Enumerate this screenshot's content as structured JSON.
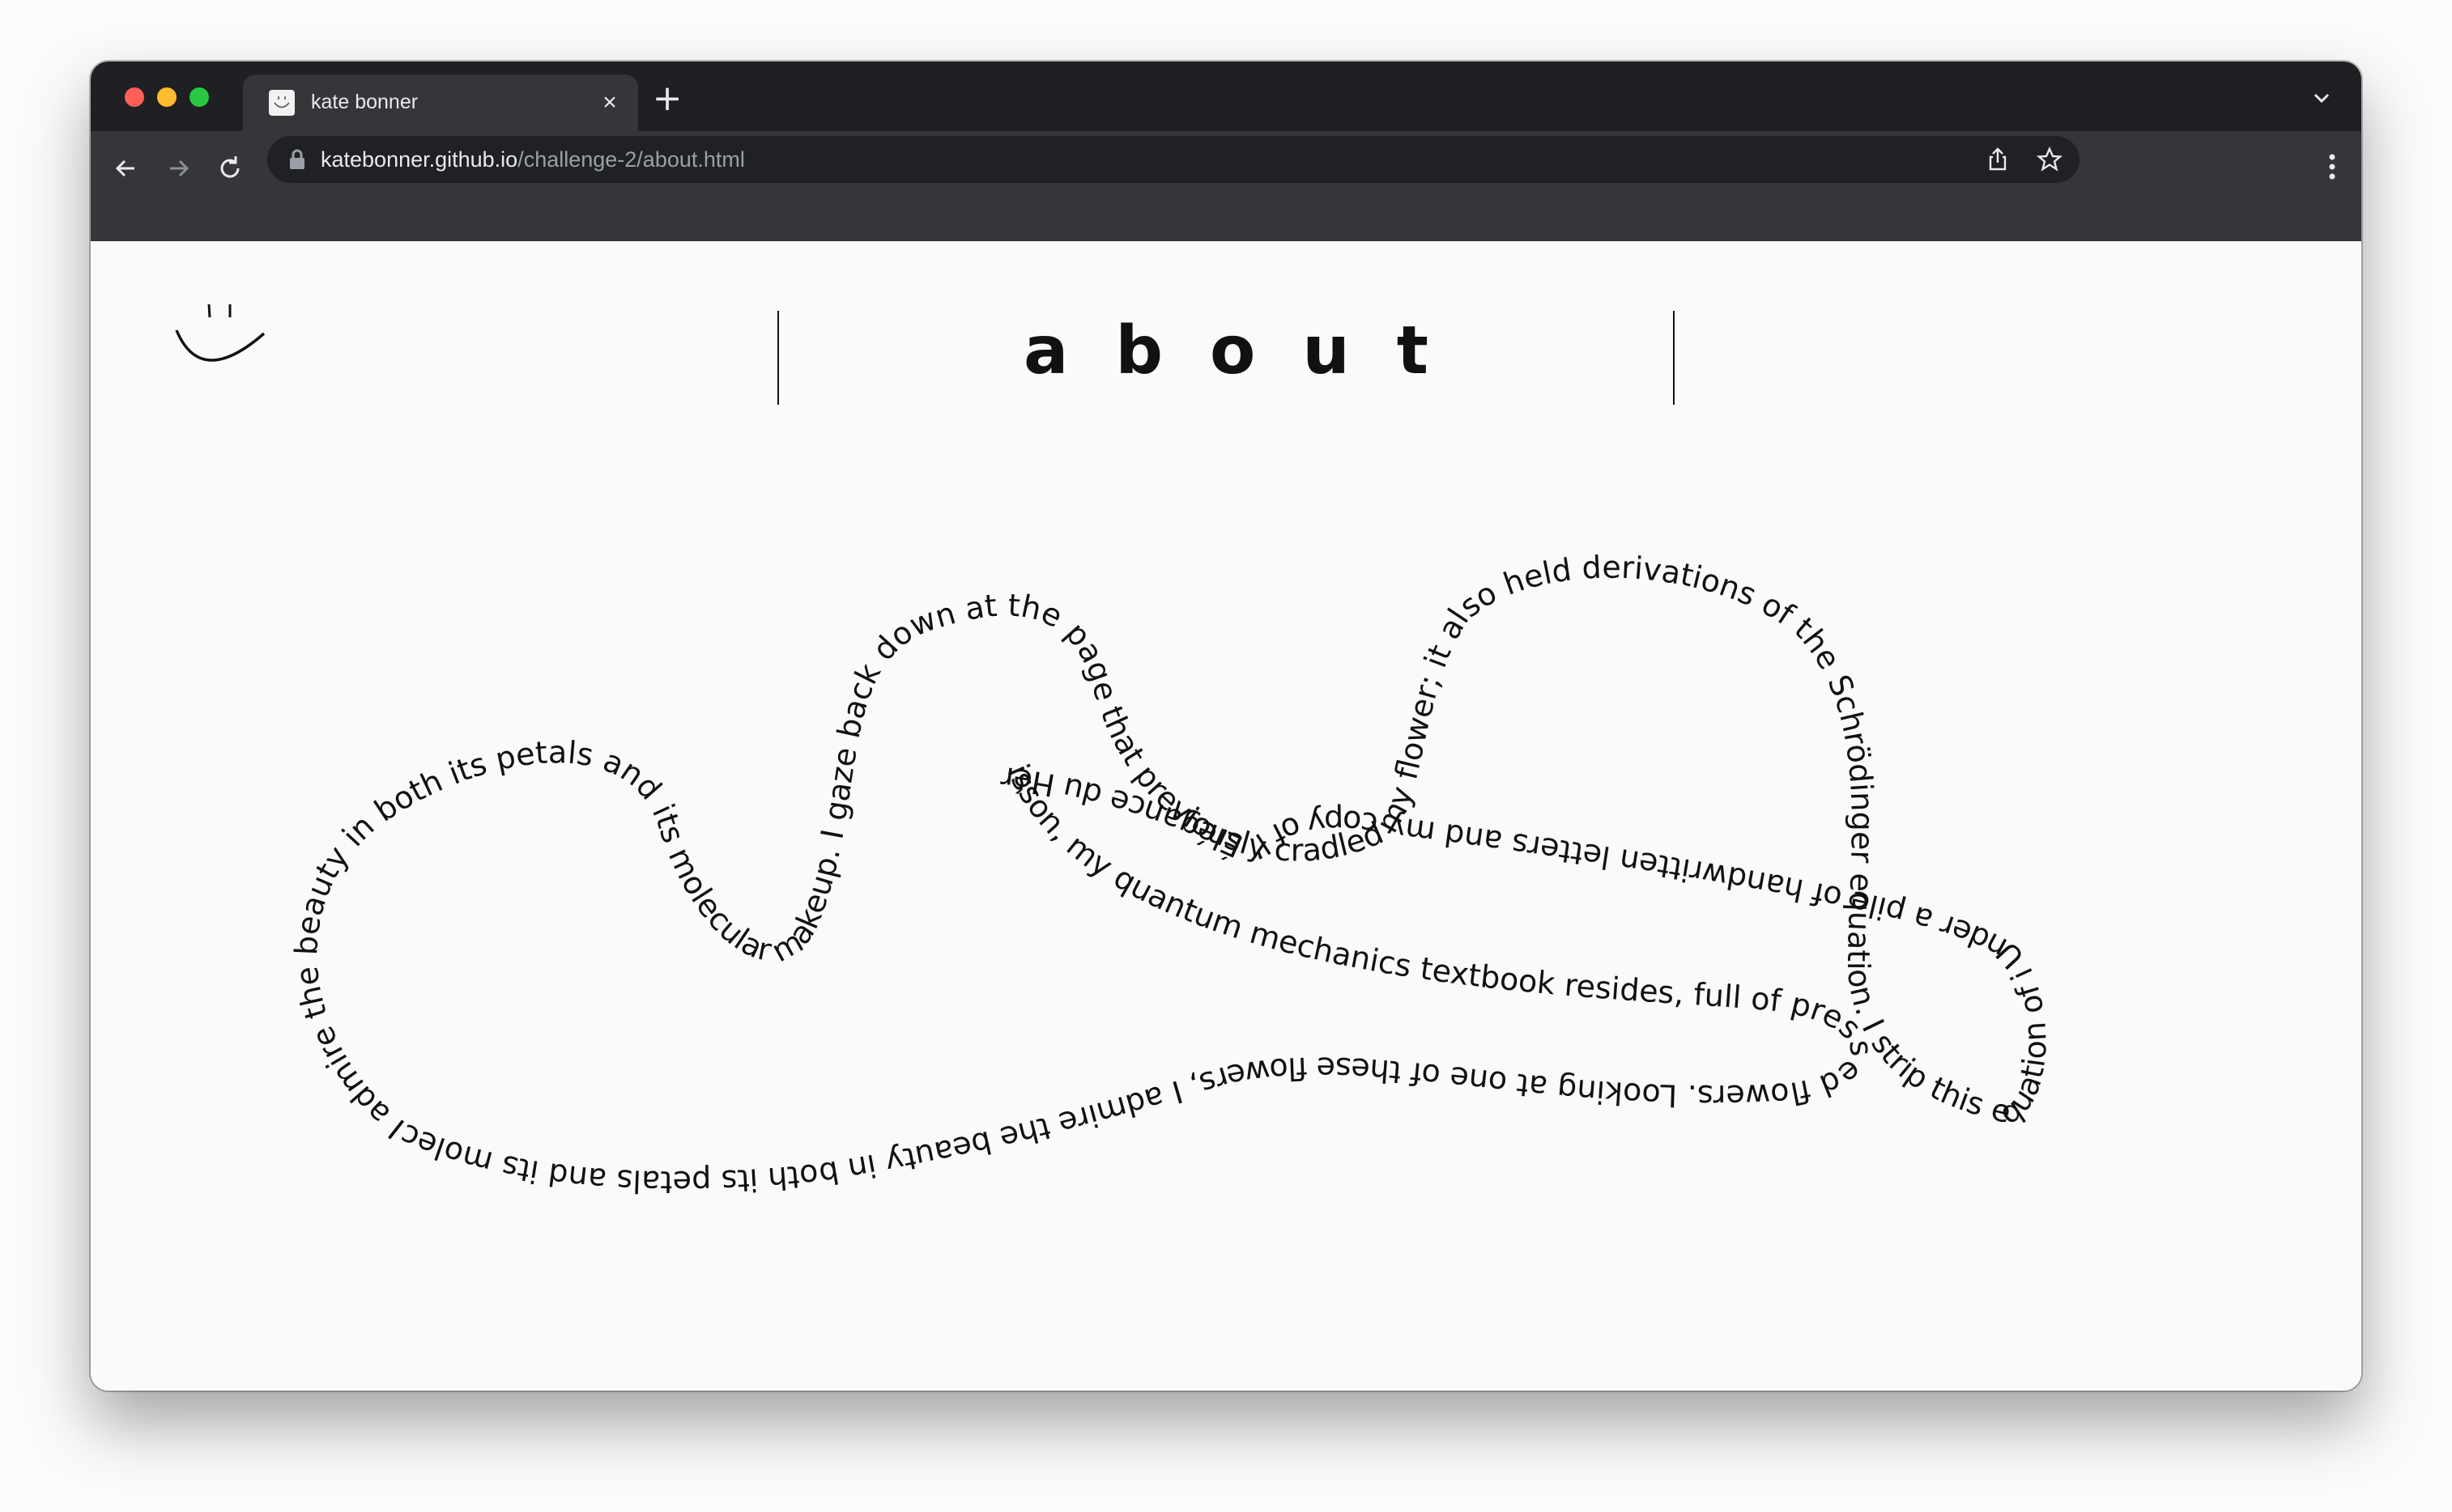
{
  "browser": {
    "tab_title": "kate bonner",
    "new_tab_symbol": "+",
    "close_symbol": "×",
    "url_host": "katebonner.github.io",
    "url_path": "/challenge-2/about.html"
  },
  "page": {
    "title": "about",
    "logo_icon": "smiley-face-icon",
    "wavy_text": "I admire the beauty in both its petals and its molecular makeup. I gaze back down at the page that previously cradled my flower; it also held derivations of the Schrödinger equation. I strip this equation of i Under a pile of handwritten letters and my copy of l’Élégance du Hérisson, my quantum mechanics textbook resides, full of pressed flowers. Looking at one of these flowers, I admire the beauty in both its petals and its molecular makeup."
  },
  "colors": {
    "chrome_dark": "#1f2023",
    "chrome_toolbar": "#35363a",
    "page_background": "#fafafa",
    "text": "#111111"
  }
}
